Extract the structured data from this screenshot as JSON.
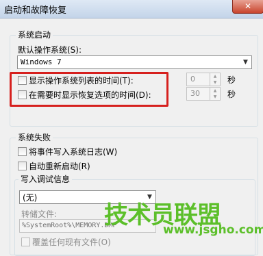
{
  "window": {
    "title": "启动和故障恢复",
    "close_glyph": "✕"
  },
  "startup": {
    "group_label": "系统启动",
    "default_os_label": "默认操作系统(S):",
    "default_os_value": "Windows 7",
    "show_os_list": {
      "label": "显示操作系统列表的时间(T):",
      "checked": false,
      "value": "0",
      "unit": "秒"
    },
    "show_recovery": {
      "label": "在需要时显示恢复选项的时间(D):",
      "checked": false,
      "value": "30",
      "unit": "秒"
    }
  },
  "failure": {
    "group_label": "系统失败",
    "write_event": {
      "label": "将事件写入系统日志(W)",
      "checked": false
    },
    "auto_restart": {
      "label": "自动重新启动(R)",
      "checked": false
    },
    "debug": {
      "group_label": "写入调试信息",
      "type_value": "(无)",
      "dump_file_label": "转储文件:",
      "dump_file_value": "%SystemRoot%\\MEMORY.DMP",
      "overwrite_label": "覆盖任何现有文件(O)"
    }
  },
  "watermark": {
    "main": "技术员联盟",
    "url": "www.jsgho.com"
  },
  "colors": {
    "highlight": "#d6201e",
    "watermark": "#5cbf2a"
  }
}
